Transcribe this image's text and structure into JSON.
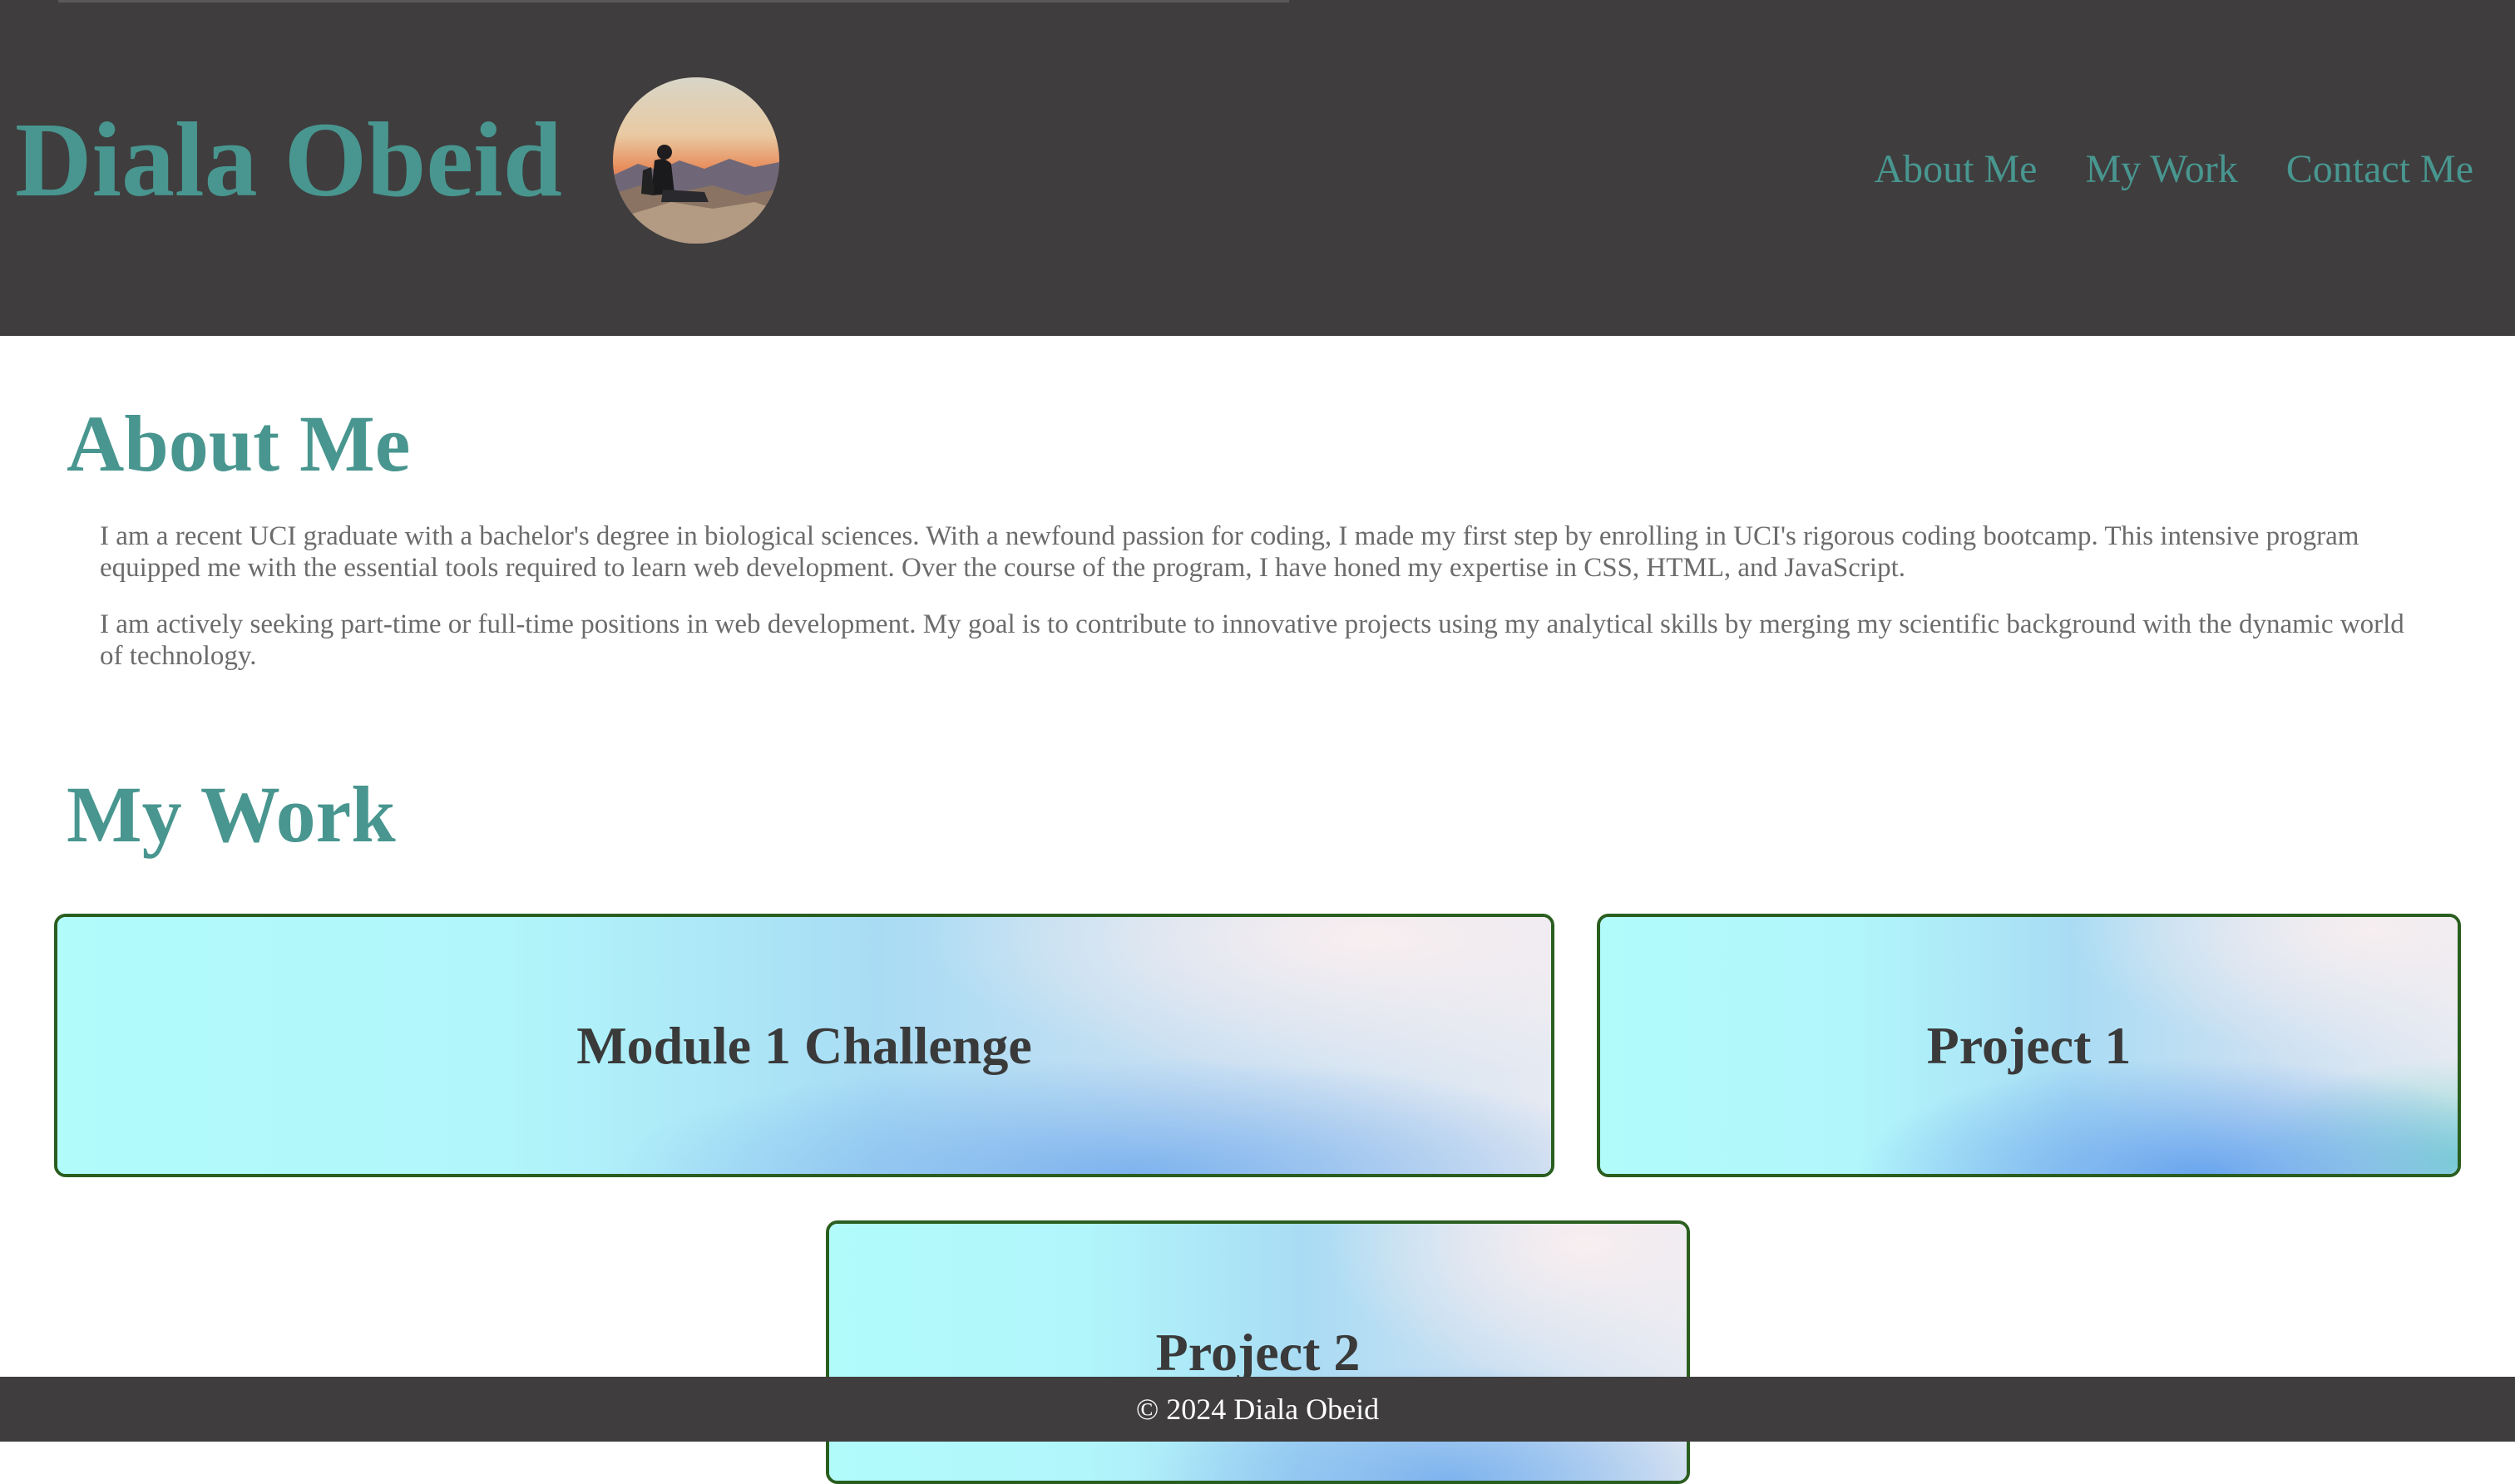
{
  "header": {
    "name": "Diala Obeid",
    "avatar_alt": "profile photo of a person sitting on rocks at sunset",
    "nav": [
      {
        "label": "About Me"
      },
      {
        "label": "My Work"
      },
      {
        "label": "Contact Me"
      }
    ]
  },
  "about": {
    "title": "About Me",
    "paragraphs": [
      "I am a recent UCI graduate with a bachelor's degree in biological sciences. With a newfound passion for coding, I made my first step by enrolling in UCI's rigorous coding bootcamp. This intensive program equipped me with the essential tools required to learn web development. Over the course of the program, I have honed my expertise in CSS, HTML, and JavaScript.",
      "I am actively seeking part-time or full-time positions in web development. My goal is to contribute to innovative projects using my analytical skills by merging my scientific background with the dynamic world of technology."
    ]
  },
  "work": {
    "title": "My Work",
    "cards": [
      {
        "label": "Module 1 Challenge"
      },
      {
        "label": "Project 1"
      },
      {
        "label": "Project 2"
      }
    ]
  },
  "footer": {
    "text": "© 2024 Diala Obeid"
  },
  "colors": {
    "header_bg": "#3f3d3e",
    "accent_teal": "#48968f",
    "card_border": "#2a5e1f"
  }
}
